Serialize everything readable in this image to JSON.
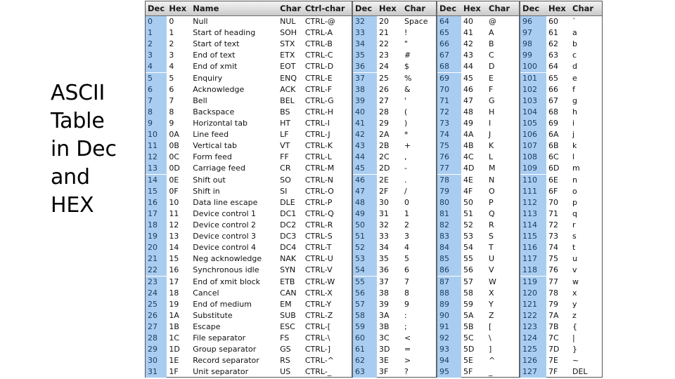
{
  "title": {
    "text": "ASCII\nTable\nin Dec\nand\nHEX"
  },
  "colors": {
    "dec_column_highlight": "#a9cdf0",
    "header_background": "#e4e4e4",
    "border": "#555555",
    "text": "#111111",
    "page_background": "#ffffff"
  },
  "table": {
    "blocks": [
      {
        "id": "block-control-chars",
        "headers": [
          "Dec",
          "Hex",
          "Name",
          "Char",
          "Ctrl-char"
        ],
        "rows": [
          [
            "0",
            "0",
            "Null",
            "NUL",
            "CTRL-@"
          ],
          [
            "1",
            "1",
            "Start of heading",
            "SOH",
            "CTRL-A"
          ],
          [
            "2",
            "2",
            "Start of text",
            "STX",
            "CTRL-B"
          ],
          [
            "3",
            "3",
            "End of text",
            "ETX",
            "CTRL-C"
          ],
          [
            "4",
            "4",
            "End of xmit",
            "EOT",
            "CTRL-D"
          ],
          [
            "5",
            "5",
            "Enquiry",
            "ENQ",
            "CTRL-E"
          ],
          [
            "6",
            "6",
            "Acknowledge",
            "ACK",
            "CTRL-F"
          ],
          [
            "7",
            "7",
            "Bell",
            "BEL",
            "CTRL-G"
          ],
          [
            "8",
            "8",
            "Backspace",
            "BS",
            "CTRL-H"
          ],
          [
            "9",
            "9",
            "Horizontal tab",
            "HT",
            "CTRL-I"
          ],
          [
            "10",
            "0A",
            "Line feed",
            "LF",
            "CTRL-J"
          ],
          [
            "11",
            "0B",
            "Vertical tab",
            "VT",
            "CTRL-K"
          ],
          [
            "12",
            "0C",
            "Form feed",
            "FF",
            "CTRL-L"
          ],
          [
            "13",
            "0D",
            "Carriage feed",
            "CR",
            "CTRL-M"
          ],
          [
            "14",
            "0E",
            "Shift out",
            "SO",
            "CTRL-N"
          ],
          [
            "15",
            "0F",
            "Shift in",
            "SI",
            "CTRL-O"
          ],
          [
            "16",
            "10",
            "Data line escape",
            "DLE",
            "CTRL-P"
          ],
          [
            "17",
            "11",
            "Device control 1",
            "DC1",
            "CTRL-Q"
          ],
          [
            "18",
            "12",
            "Device control 2",
            "DC2",
            "CTRL-R"
          ],
          [
            "19",
            "13",
            "Device control 3",
            "DC3",
            "CTRL-S"
          ],
          [
            "20",
            "14",
            "Device control 4",
            "DC4",
            "CTRL-T"
          ],
          [
            "21",
            "15",
            "Neg acknowledge",
            "NAK",
            "CTRL-U"
          ],
          [
            "22",
            "16",
            "Synchronous idle",
            "SYN",
            "CTRL-V"
          ],
          [
            "23",
            "17",
            "End of xmit block",
            "ETB",
            "CTRL-W"
          ],
          [
            "24",
            "18",
            "Cancel",
            "CAN",
            "CTRL-X"
          ],
          [
            "25",
            "19",
            "End of medium",
            "EM",
            "CTRL-Y"
          ],
          [
            "26",
            "1A",
            "Substitute",
            "SUB",
            "CTRL-Z"
          ],
          [
            "27",
            "1B",
            "Escape",
            "ESC",
            "CTRL-["
          ],
          [
            "28",
            "1C",
            "File separator",
            "FS",
            "CTRL-\\"
          ],
          [
            "29",
            "1D",
            "Group separator",
            "GS",
            "CTRL-]"
          ],
          [
            "30",
            "1E",
            "Record separator",
            "RS",
            "CTRL-^"
          ],
          [
            "31",
            "1F",
            "Unit separator",
            "US",
            "CTRL-_"
          ]
        ]
      },
      {
        "id": "block-printable-32-63",
        "headers": [
          "Dec",
          "Hex",
          "Char"
        ],
        "rows": [
          [
            "32",
            "20",
            "Space"
          ],
          [
            "33",
            "21",
            "!"
          ],
          [
            "34",
            "22",
            "\""
          ],
          [
            "35",
            "23",
            "#"
          ],
          [
            "36",
            "24",
            "$"
          ],
          [
            "37",
            "25",
            "%"
          ],
          [
            "38",
            "26",
            "&"
          ],
          [
            "39",
            "27",
            "'"
          ],
          [
            "40",
            "28",
            "("
          ],
          [
            "41",
            "29",
            ")"
          ],
          [
            "42",
            "2A",
            "*"
          ],
          [
            "43",
            "2B",
            "+"
          ],
          [
            "44",
            "2C",
            ","
          ],
          [
            "45",
            "2D",
            "-"
          ],
          [
            "46",
            "2E",
            "."
          ],
          [
            "47",
            "2F",
            "/"
          ],
          [
            "48",
            "30",
            "0"
          ],
          [
            "49",
            "31",
            "1"
          ],
          [
            "50",
            "32",
            "2"
          ],
          [
            "51",
            "33",
            "3"
          ],
          [
            "52",
            "34",
            "4"
          ],
          [
            "53",
            "35",
            "5"
          ],
          [
            "54",
            "36",
            "6"
          ],
          [
            "55",
            "37",
            "7"
          ],
          [
            "56",
            "38",
            "8"
          ],
          [
            "57",
            "39",
            "9"
          ],
          [
            "58",
            "3A",
            ":"
          ],
          [
            "59",
            "3B",
            ";"
          ],
          [
            "60",
            "3C",
            "<"
          ],
          [
            "61",
            "3D",
            "="
          ],
          [
            "62",
            "3E",
            ">"
          ],
          [
            "63",
            "3F",
            "?"
          ]
        ]
      },
      {
        "id": "block-printable-64-95",
        "headers": [
          "Dec",
          "Hex",
          "Char"
        ],
        "rows": [
          [
            "64",
            "40",
            "@"
          ],
          [
            "65",
            "41",
            "A"
          ],
          [
            "66",
            "42",
            "B"
          ],
          [
            "67",
            "43",
            "C"
          ],
          [
            "68",
            "44",
            "D"
          ],
          [
            "69",
            "45",
            "E"
          ],
          [
            "70",
            "46",
            "F"
          ],
          [
            "71",
            "47",
            "G"
          ],
          [
            "72",
            "48",
            "H"
          ],
          [
            "73",
            "49",
            "I"
          ],
          [
            "74",
            "4A",
            "J"
          ],
          [
            "75",
            "4B",
            "K"
          ],
          [
            "76",
            "4C",
            "L"
          ],
          [
            "77",
            "4D",
            "M"
          ],
          [
            "78",
            "4E",
            "N"
          ],
          [
            "79",
            "4F",
            "O"
          ],
          [
            "80",
            "50",
            "P"
          ],
          [
            "81",
            "51",
            "Q"
          ],
          [
            "82",
            "52",
            "R"
          ],
          [
            "83",
            "53",
            "S"
          ],
          [
            "84",
            "54",
            "T"
          ],
          [
            "85",
            "55",
            "U"
          ],
          [
            "86",
            "56",
            "V"
          ],
          [
            "87",
            "57",
            "W"
          ],
          [
            "88",
            "58",
            "X"
          ],
          [
            "89",
            "59",
            "Y"
          ],
          [
            "90",
            "5A",
            "Z"
          ],
          [
            "91",
            "5B",
            "["
          ],
          [
            "92",
            "5C",
            "\\"
          ],
          [
            "93",
            "5D",
            "]"
          ],
          [
            "94",
            "5E",
            "^"
          ],
          [
            "95",
            "5F",
            "_"
          ]
        ]
      },
      {
        "id": "block-printable-96-127",
        "headers": [
          "Dec",
          "Hex",
          "Char"
        ],
        "rows": [
          [
            "96",
            "60",
            "`"
          ],
          [
            "97",
            "61",
            "a"
          ],
          [
            "98",
            "62",
            "b"
          ],
          [
            "99",
            "63",
            "c"
          ],
          [
            "100",
            "64",
            "d"
          ],
          [
            "101",
            "65",
            "e"
          ],
          [
            "102",
            "66",
            "f"
          ],
          [
            "103",
            "67",
            "g"
          ],
          [
            "104",
            "68",
            "h"
          ],
          [
            "105",
            "69",
            "i"
          ],
          [
            "106",
            "6A",
            "j"
          ],
          [
            "107",
            "6B",
            "k"
          ],
          [
            "108",
            "6C",
            "l"
          ],
          [
            "109",
            "6D",
            "m"
          ],
          [
            "110",
            "6E",
            "n"
          ],
          [
            "111",
            "6F",
            "o"
          ],
          [
            "112",
            "70",
            "p"
          ],
          [
            "113",
            "71",
            "q"
          ],
          [
            "114",
            "72",
            "r"
          ],
          [
            "115",
            "73",
            "s"
          ],
          [
            "116",
            "74",
            "t"
          ],
          [
            "117",
            "75",
            "u"
          ],
          [
            "118",
            "76",
            "v"
          ],
          [
            "119",
            "77",
            "w"
          ],
          [
            "120",
            "78",
            "x"
          ],
          [
            "121",
            "79",
            "y"
          ],
          [
            "122",
            "7A",
            "z"
          ],
          [
            "123",
            "7B",
            "{"
          ],
          [
            "124",
            "7C",
            "|"
          ],
          [
            "125",
            "7D",
            "}"
          ],
          [
            "126",
            "7E",
            "~"
          ],
          [
            "127",
            "7F",
            "DEL"
          ]
        ]
      }
    ]
  }
}
